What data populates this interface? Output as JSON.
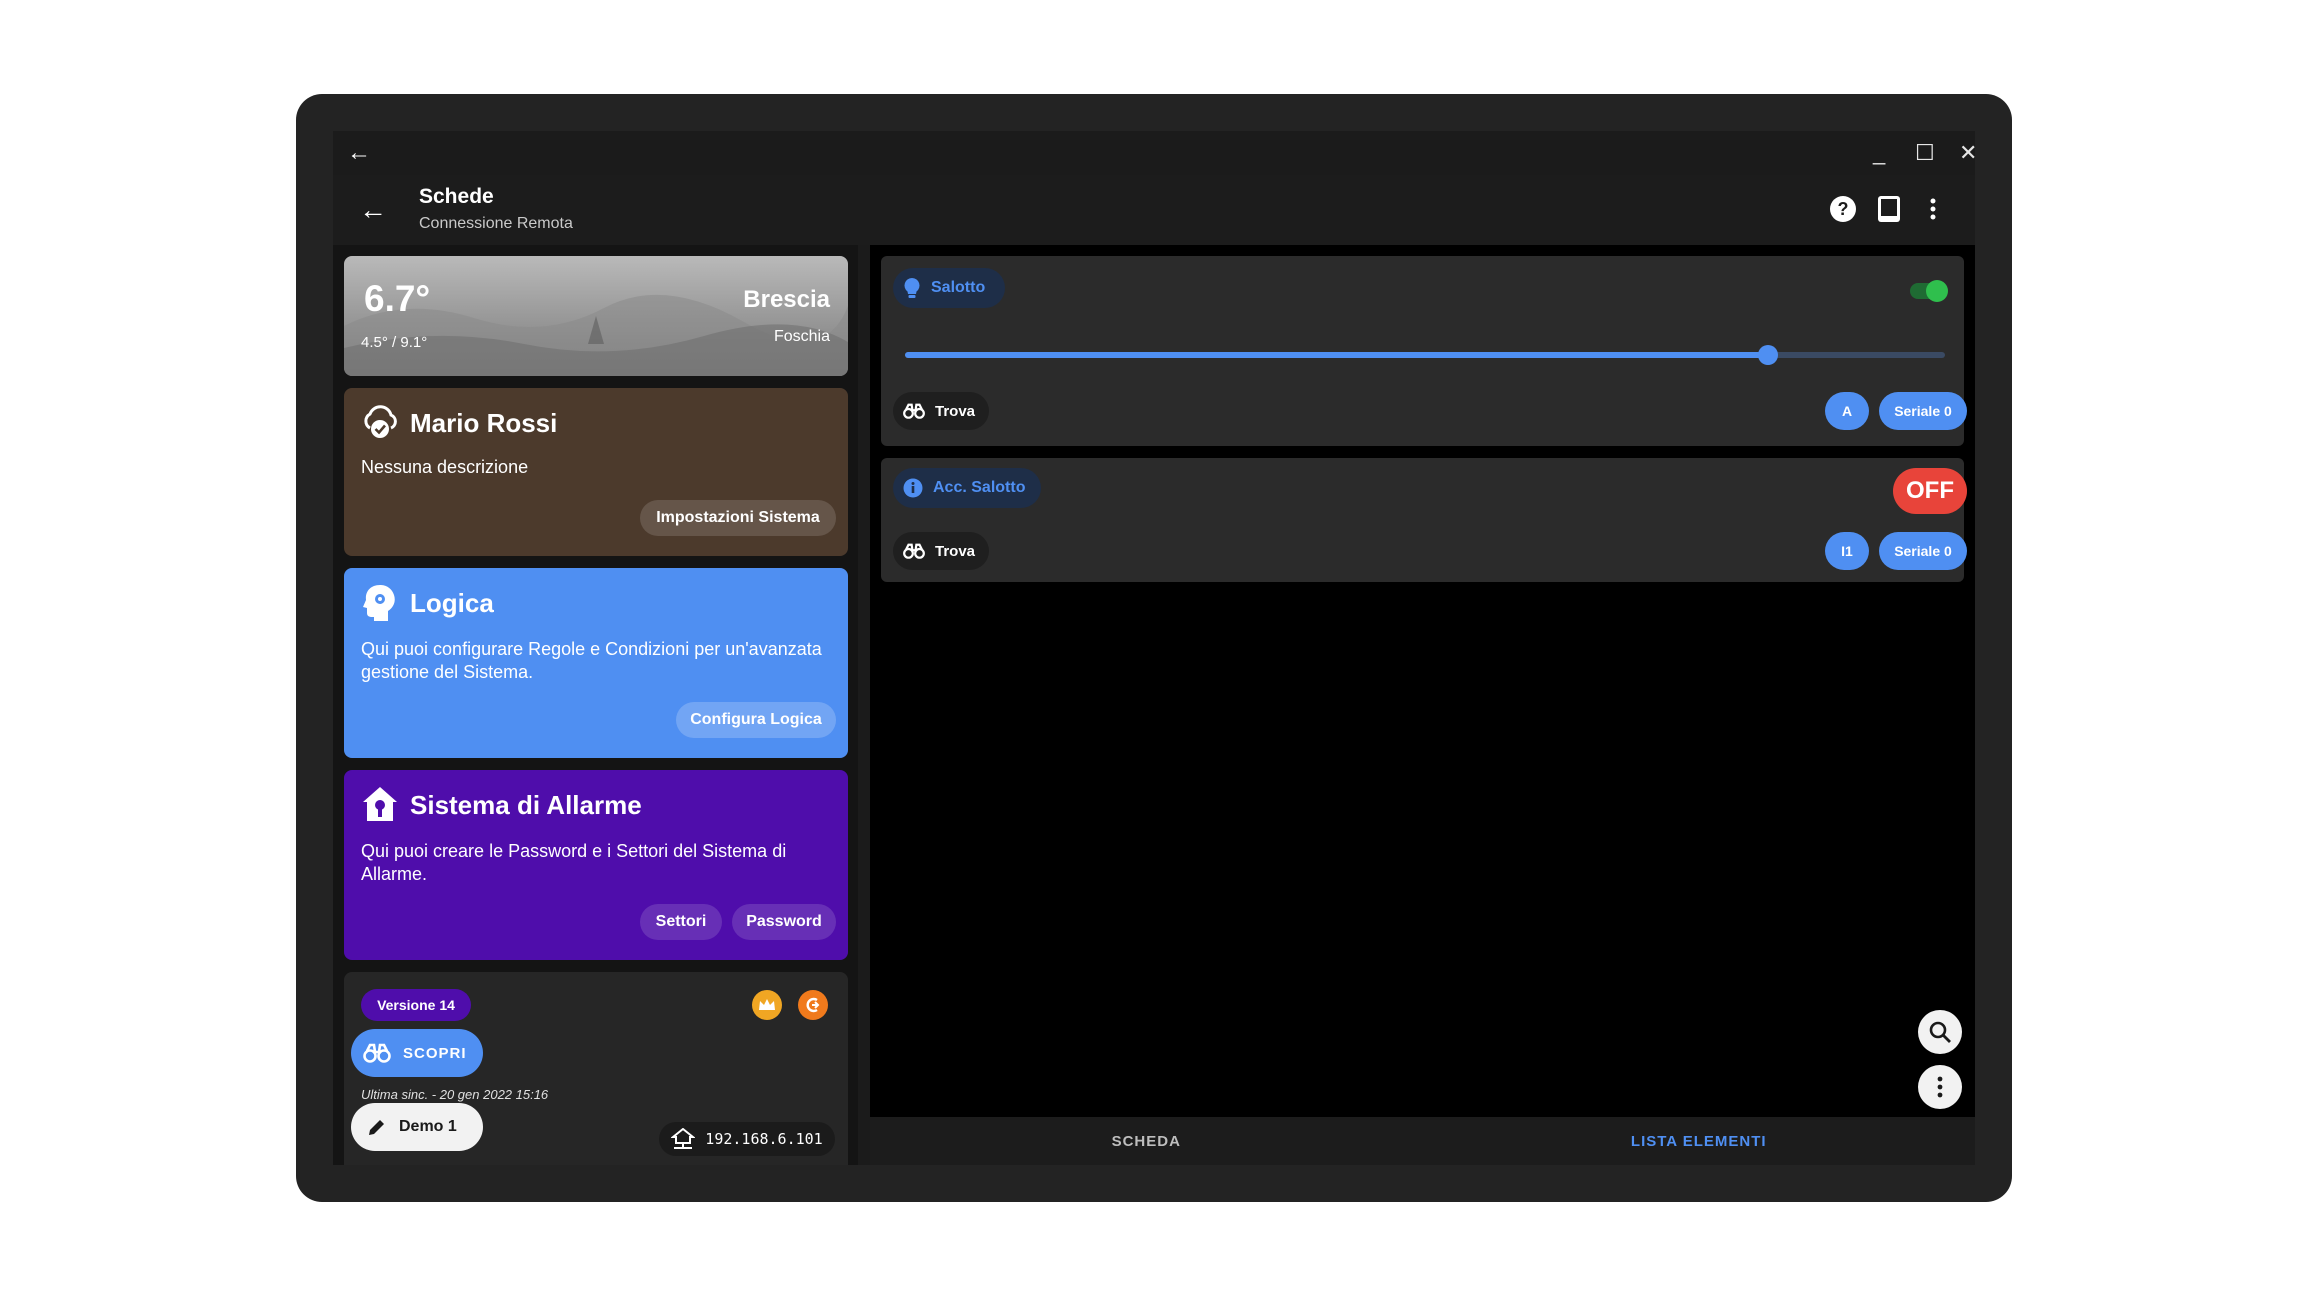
{
  "window": {
    "back": "←",
    "minimize": "_",
    "maximize": "☐",
    "close": "✕"
  },
  "appbar": {
    "back": "←",
    "title": "Schede",
    "subtitle": "Connessione Remota"
  },
  "weather": {
    "temp": "6.7°",
    "range": "4.5° / 9.1°",
    "city": "Brescia",
    "condition": "Foschia"
  },
  "user": {
    "name": "Mario Rossi",
    "description": "Nessuna descrizione",
    "button": "Impostazioni Sistema"
  },
  "logic": {
    "title": "Logica",
    "description": "Qui puoi configurare Regole e Condizioni per un'avanzata gestione del Sistema.",
    "button": "Configura Logica"
  },
  "alarm": {
    "title": "Sistema di Allarme",
    "description": "Qui puoi creare le Password e i Settori del Sistema di Allarme.",
    "btn_sectors": "Settori",
    "btn_password": "Password"
  },
  "bottom": {
    "version": "Versione 14",
    "discover": "SCOPRI",
    "last_sync": "Ultima sinc. - 20 gen 2022 15:16",
    "demo": "Demo 1",
    "ip": "192.168.6.101"
  },
  "elements": [
    {
      "name": "Salotto",
      "find": "Trova",
      "badge": "A",
      "serial": "Seriale 0",
      "switch_on": true,
      "slider_fraction": 0.83
    },
    {
      "name": "Acc. Salotto",
      "find": "Trova",
      "badge": "I1",
      "serial": "Seriale 0",
      "state": "OFF"
    }
  ],
  "tabs": {
    "scheda": "SCHEDA",
    "lista": "LISTA ELEMENTI",
    "active": "lista"
  },
  "colors": {
    "accent": "#4f8ff2",
    "off": "#e8443a",
    "switch": "#2fbf4d",
    "alarm": "#4f0dab",
    "user": "#4c3a2c"
  }
}
